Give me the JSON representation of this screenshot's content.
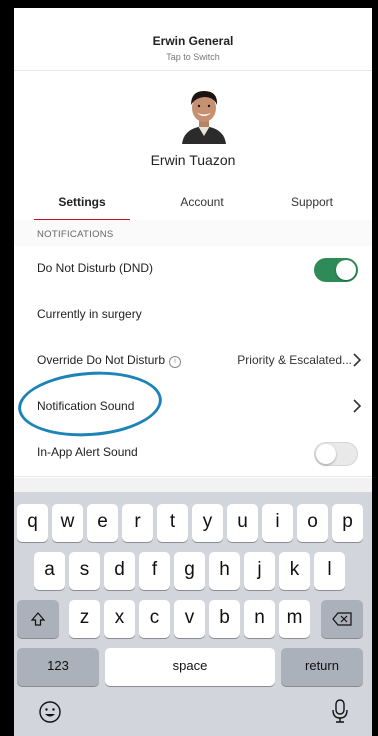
{
  "workspace": {
    "name": "Erwin General",
    "subtitle": "Tap to Switch"
  },
  "user": {
    "name": "Erwin Tuazon"
  },
  "tabs": [
    {
      "label": "Settings",
      "active": true
    },
    {
      "label": "Account",
      "active": false
    },
    {
      "label": "Support",
      "active": false
    }
  ],
  "notifications": {
    "header": "NOTIFICATIONS",
    "dnd_label": "Do Not Disturb (DND)",
    "dnd_enabled": true,
    "status_text": "Currently in surgery",
    "override_label": "Override Do Not Disturb",
    "override_value": "Priority & Escalated...",
    "sound_label": "Notification Sound",
    "in_app_label": "In-App Alert Sound",
    "in_app_enabled": false
  },
  "keyboard": {
    "row1": [
      "q",
      "w",
      "e",
      "r",
      "t",
      "y",
      "u",
      "i",
      "o",
      "p"
    ],
    "row2": [
      "a",
      "s",
      "d",
      "f",
      "g",
      "h",
      "j",
      "k",
      "l"
    ],
    "row3": [
      "z",
      "x",
      "c",
      "v",
      "b",
      "n",
      "m"
    ],
    "numbers_label": "123",
    "space_label": "space",
    "return_label": "return"
  },
  "colors": {
    "accent": "#c8102e",
    "toggle_on": "#2e8b57",
    "annotation": "#1e84b8"
  },
  "icons": [
    "info-icon",
    "chevron-right-icon",
    "shift-icon",
    "backspace-icon",
    "emoji-icon",
    "microphone-icon"
  ]
}
